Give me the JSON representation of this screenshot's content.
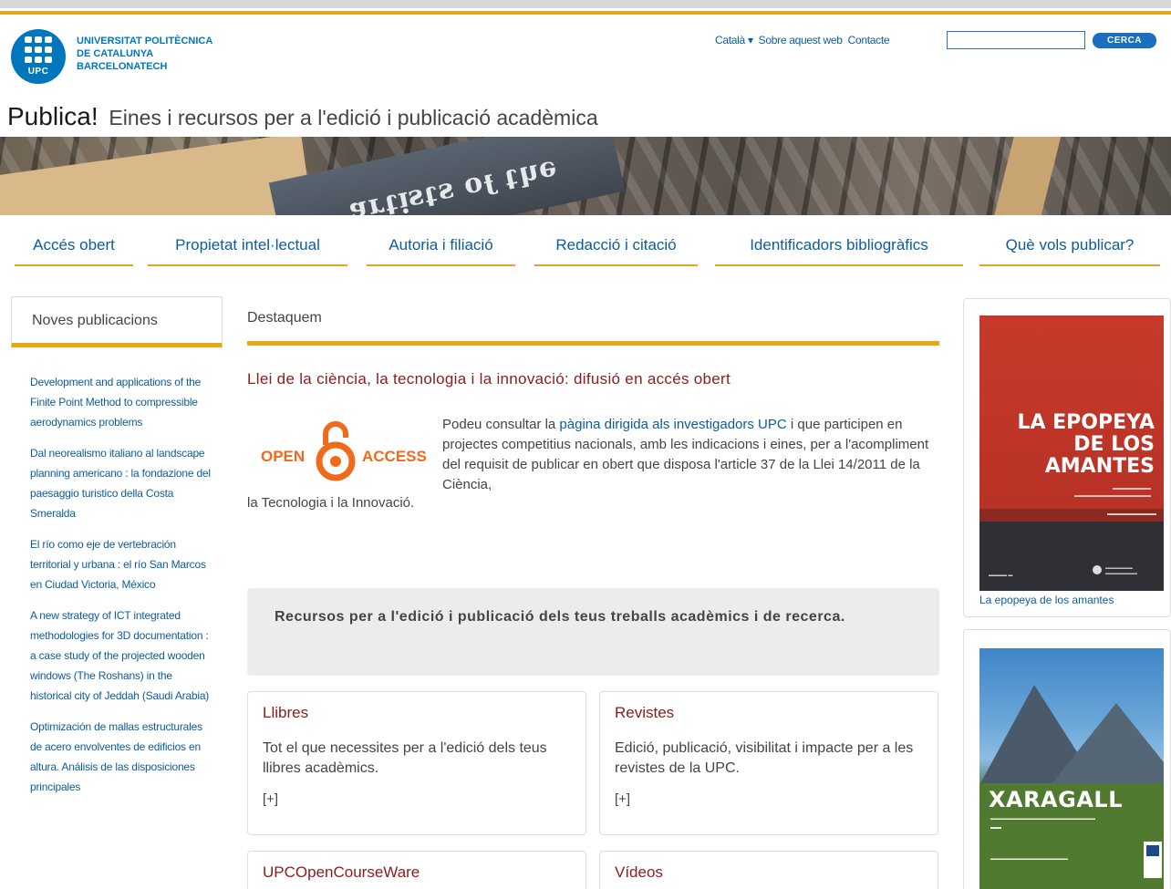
{
  "header": {
    "logo_text": "UPC",
    "university": [
      "UNIVERSITAT POLITÈCNICA",
      "DE CATALUNYA",
      "BARCELONATECH"
    ],
    "toplinks": {
      "language": "Català",
      "about": "Sobre aquest web",
      "contact": "Contacte"
    },
    "search": {
      "placeholder": "",
      "button_label": "CERCA"
    }
  },
  "site": {
    "title": "Publica!",
    "subtitle": "Eines i recursos per a l'edició i publicació acadèmica"
  },
  "nav": {
    "items": [
      {
        "label": "Accés obert"
      },
      {
        "label": "Propietat intel·lectual"
      },
      {
        "label": "Autoria i filiació"
      },
      {
        "label": "Redacció i citació"
      },
      {
        "label": "Identificadors bibliogràfics"
      },
      {
        "label": "Què vols publicar?"
      }
    ]
  },
  "sidebar": {
    "heading": "Noves publicacions",
    "items": [
      "Development and applications of the Finite Point Method to compressible aerodynamics problems",
      "Dal neorealismo italiano al landscape planning americano : la fondazione del paesaggio turistico della Costa Smeralda",
      "El río como eje de vertebración territorial y urbana : el río San Marcos en Ciudad Victoria, México",
      "A new strategy of ICT integrated methodologies for 3D documentation : a case study of the projected wooden windows (The Roshans) in the historical city of Jeddah (Saudi Arabia)",
      "Optimización de mallas estructurales de acero envolventes de edificios en altura. Análisis de las disposiciones principales"
    ]
  },
  "main": {
    "section_heading": "Destaquem",
    "article": {
      "title": "Llei de la ciència, la tecnologia i la innovació: difusió en accés obert",
      "logo_open": "OPEN",
      "logo_access": "ACCESS",
      "text_before_link": "Podeu consultar la ",
      "link_text": "pàgina dirigida als investigadors UPC",
      "text_after_link": " i que participen en projectes competitius nacionals, amb les indicacions i eines, per a l'acompliment del requisit de publicar en obert que disposa l'article 37 de la Llei 14/2011 de la Ciència,",
      "text_last_line": "la Tecnologia i la Innovació."
    },
    "resources_heading": "Recursos per a l'edició i publicació dels teus treballs acadèmics i de recerca.",
    "cards": [
      {
        "title": "Llibres",
        "desc": "Tot el que necessites per a l'edició dels teus llibres acadèmics.",
        "more": "[+]"
      },
      {
        "title": "Revistes",
        "desc": "Edició, publicació, visibilitat i impacte per a les revistes de la UPC.",
        "more": "[+]"
      },
      {
        "title": "UPCOpenCourseWare",
        "desc": "",
        "more": ""
      },
      {
        "title": "Vídeos",
        "desc": "",
        "more": ""
      }
    ]
  },
  "right": {
    "book1": {
      "cover_title": [
        "LA EPOPEYA",
        "DE LOS",
        "AMANTES"
      ],
      "caption": "La epopeya de los amantes"
    },
    "book2": {
      "cover_title": "XARAGALL"
    }
  },
  "colors": {
    "accent": "#e6a817",
    "link": "#0b5c9e",
    "heading_red": "#8c1c1c",
    "upc_blue": "#0076bd",
    "open_access_orange": "#f06a1a"
  }
}
